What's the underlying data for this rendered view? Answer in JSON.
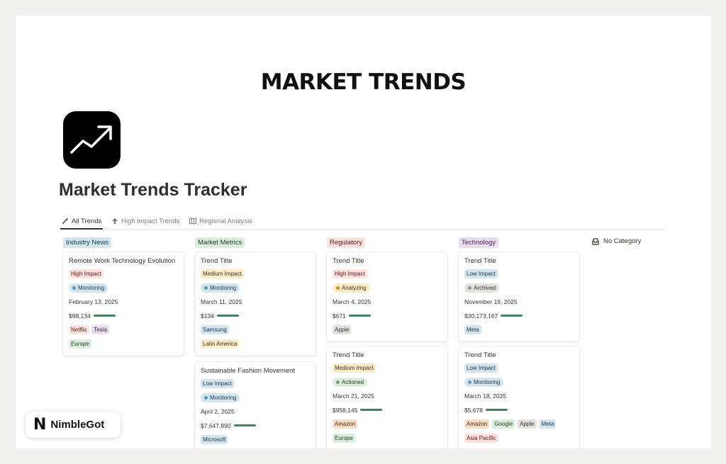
{
  "banner": {
    "text": "MARKET TRENDS"
  },
  "page": {
    "title": "Market Trends Tracker",
    "icon": "trend-up-icon"
  },
  "tabs": [
    {
      "label": "All Trends",
      "icon": "magic-wand-icon",
      "active": true
    },
    {
      "label": "High Impact Trends",
      "icon": "arrow-up-icon",
      "active": false
    },
    {
      "label": "Regional Analysis",
      "icon": "map-icon",
      "active": false
    }
  ],
  "columns": [
    {
      "name": "Industry News",
      "bg": "#d3e5ef",
      "fg": "#183347",
      "cards": [
        {
          "title": "Remote Work Technology Evolution",
          "impact": "High Impact",
          "status": "Monitoring",
          "date": "February 13, 2025",
          "value": "$98,134",
          "companies": [
            "Netflix",
            "Tesla"
          ],
          "regions": [
            "Europe"
          ]
        }
      ]
    },
    {
      "name": "Market Metrics",
      "bg": "#dbeddb",
      "fg": "#1c3829",
      "cards": [
        {
          "title": "Trend Title",
          "impact": "Medium Impact",
          "status": "Monitoring",
          "date": "March 11, 2025",
          "value": "$134",
          "companies": [
            "Samsung"
          ],
          "regions": [
            "Latin America"
          ]
        },
        {
          "title": "Sustainable Fashion Movement",
          "impact": "Low Impact",
          "status": "Monitoring",
          "date": "April 2, 2025",
          "value": "$7,647,890",
          "companies": [
            "Microsoft"
          ],
          "regions": []
        }
      ]
    },
    {
      "name": "Regulatory",
      "bg": "#ffe2dd",
      "fg": "#5d1715",
      "cards": [
        {
          "title": "Trend Title",
          "impact": "High Impact",
          "status": "Analyzing",
          "date": "March 4, 2025",
          "value": "$671",
          "companies": [
            "Apple"
          ],
          "regions": []
        },
        {
          "title": "Trend Title",
          "impact": "Medium Impact",
          "status": "Actioned",
          "date": "March 21, 2025",
          "value": "$958,145",
          "companies": [
            "Amazon"
          ],
          "regions": [
            "Europe"
          ]
        }
      ]
    },
    {
      "name": "Technology",
      "bg": "#e8deee",
      "fg": "#412454",
      "cards": [
        {
          "title": "Trend Title",
          "impact": "Low Impact",
          "status": "Archived",
          "date": "November 19, 2025",
          "value": "$30,173,167",
          "companies": [
            "Meta"
          ],
          "regions": []
        },
        {
          "title": "Trend Title",
          "impact": "Low Impact",
          "status": "Monitoring",
          "date": "March 18, 2025",
          "value": "$5,678",
          "companies": [
            "Amazon",
            "Google",
            "Apple",
            "Meta"
          ],
          "regions": [
            "Asia Pacific"
          ]
        }
      ]
    }
  ],
  "no_category": {
    "label": "No Category",
    "icon": "inbox-icon"
  },
  "watermark": {
    "logo": "N",
    "text": "NimbleGot"
  },
  "colors": {
    "impact": {
      "High Impact": [
        "#ffe2dd",
        "#5d1715"
      ],
      "Medium Impact": [
        "#fdecc8",
        "#402c1b"
      ],
      "Low Impact": [
        "#d3e5ef",
        "#183347"
      ]
    },
    "status": {
      "Monitoring": [
        "#d3e5ef",
        "#183347",
        "#5b97bd"
      ],
      "Analyzing": [
        "#fdecc8",
        "#402c1b",
        "#cb912f"
      ],
      "Actioned": [
        "#dbeddb",
        "#1c3829",
        "#6c9b7d"
      ],
      "Archived": [
        "#e3e2e0",
        "#32302c",
        "#91918e"
      ]
    },
    "company": {
      "Netflix": [
        "#ffe2dd",
        "#5d1715"
      ],
      "Tesla": [
        "#e8deee",
        "#412454"
      ],
      "Samsung": [
        "#d3e5ef",
        "#183347"
      ],
      "Microsoft": [
        "#d3e5ef",
        "#183347"
      ],
      "Apple": [
        "#e3e2e0",
        "#32302c"
      ],
      "Amazon": [
        "#fadec9",
        "#49290e"
      ],
      "Meta": [
        "#d3e5ef",
        "#183347"
      ],
      "Google": [
        "#dbeddb",
        "#1c3829"
      ]
    },
    "region": {
      "Europe": [
        "#dbeddb",
        "#1c3829"
      ],
      "Latin America": [
        "#fdecc8",
        "#402c1b"
      ],
      "Asia Pacific": [
        "#ffe2dd",
        "#5d1715"
      ]
    }
  }
}
